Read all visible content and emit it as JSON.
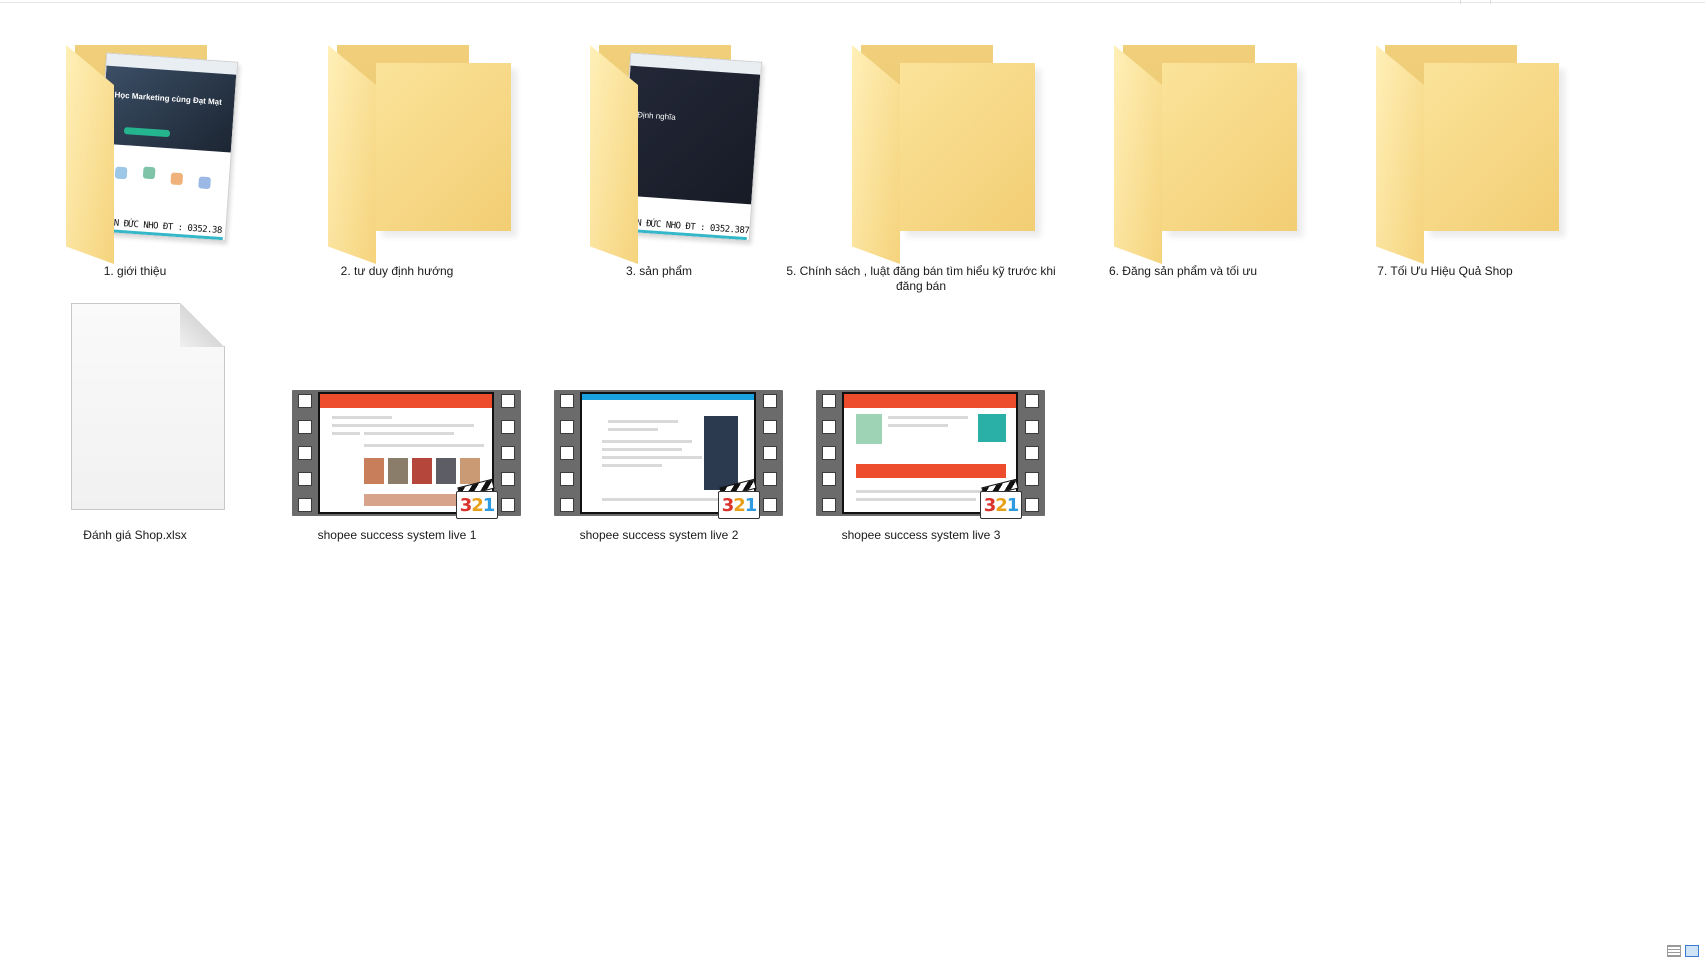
{
  "items": [
    {
      "name": "1. giới thiệu",
      "type": "folder",
      "preview": "website",
      "preview_title": "Học Marketing cùng Đạt Mạt",
      "preview_stamp": "PHAN ĐỨC NHO ĐT : 0352.38"
    },
    {
      "name": "2. tư duy định hướng",
      "type": "folder"
    },
    {
      "name": "3. sản phẩm",
      "type": "folder",
      "preview": "dark-slide",
      "preview_title": "Định nghĩa",
      "preview_stamp": "PHAN ĐỨC NHO ĐT : 0352.387"
    },
    {
      "name": "5. Chính sách , luật đăng bán tìm hiểu kỹ trước khi đăng bán",
      "type": "folder"
    },
    {
      "name": "6. Đăng sản phẩm và tối ưu",
      "type": "folder"
    },
    {
      "name": "7. Tối Ưu Hiệu Quả Shop",
      "type": "folder"
    },
    {
      "name": "Đánh giá Shop.xlsx",
      "type": "file"
    },
    {
      "name": "shopee success system live 1",
      "type": "video"
    },
    {
      "name": "shopee success system live 2",
      "type": "video"
    },
    {
      "name": "shopee success system live 3",
      "type": "video"
    }
  ],
  "video_badge": {
    "d1": "3",
    "d2": "2",
    "d3": "1"
  },
  "colors": {
    "folder": "#f5d37c",
    "shopee": "#ee4d2d",
    "background": "#ffffff"
  },
  "statusbar": {
    "views": [
      "details-view-icon",
      "large-icons-view-icon"
    ],
    "selected_view": "large-icons"
  }
}
